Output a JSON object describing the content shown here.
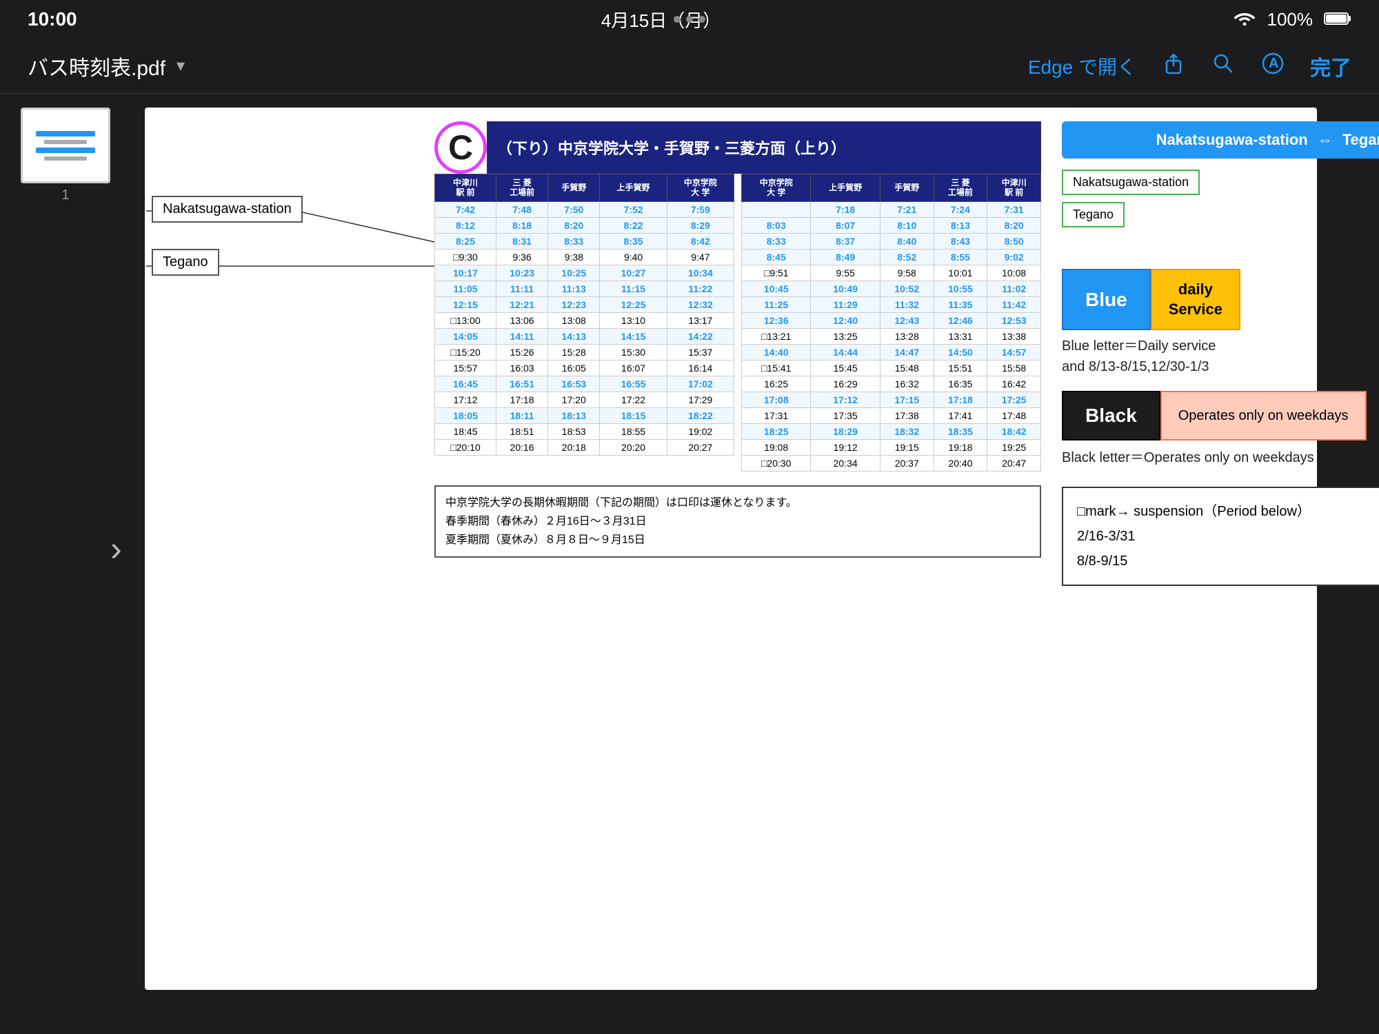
{
  "statusBar": {
    "time": "10:00",
    "date": "4月15日（月）",
    "wifi": "100%"
  },
  "toolbar": {
    "title": "バス時刻表.pdf",
    "openInEdge": "Edge で開く",
    "done": "完了"
  },
  "header": {
    "directionDown": "（下り）中京学院大学・手賀野・三菱方面（上り）",
    "routeLabel": "Nakatsugawa-station ⇔ Tegano"
  },
  "annotations": {
    "nakatsugawaStation": "Nakatsugawa-station",
    "tegano": "Tegano",
    "rightNakatsugawa": "Nakatsugawa-station",
    "rightTegano": "Tegano"
  },
  "legend": {
    "blueLabel": "Blue",
    "dailyServiceLabel": "daily\nService",
    "blueDescription": "Blue letter＝Daily service\nand 8/13-8/15,12/30-1/3",
    "blackLabel": "Black",
    "weekdaysLabel": "Operates only\non weekdays",
    "blackDescription": "Black letter＝Operates only on weekdays"
  },
  "squareMark": {
    "text": "□mark→  suspension（Period  below）\n2/16-3/31\n8/8-9/15"
  },
  "columnHeaders": {
    "left": [
      "中津川\n駅 前",
      "三 菱\n工場前",
      "手賀野",
      "上手賀野",
      "中京学院\n大 学"
    ],
    "right": [
      "中京学院\n大 学",
      "上手賀野",
      "手賀野",
      "三 菱\n工場前",
      "中津川\n駅 前"
    ]
  },
  "scheduleLeft": [
    [
      "7:42",
      "7:48",
      "7:50",
      "7:52",
      "7:59"
    ],
    [
      "8:12",
      "8:18",
      "8:20",
      "8:22",
      "8:29"
    ],
    [
      "8:25",
      "8:31",
      "8:33",
      "8:35",
      "8:42"
    ],
    [
      "□9:30",
      "9:36",
      "9:38",
      "9:40",
      "9:47"
    ],
    [
      "10:17",
      "10:23",
      "10:25",
      "10:27",
      "10:34"
    ],
    [
      "11:05",
      "11:11",
      "11:13",
      "11:15",
      "11:22"
    ],
    [
      "12:15",
      "12:21",
      "12:23",
      "12:25",
      "12:32"
    ],
    [
      "□13:00",
      "13:06",
      "13:08",
      "13:10",
      "13:17"
    ],
    [
      "14:05",
      "14:11",
      "14:13",
      "14:15",
      "14:22"
    ],
    [
      "□15:20",
      "15:26",
      "15:28",
      "15:30",
      "15:37"
    ],
    [
      "15:57",
      "16:03",
      "16:05",
      "16:07",
      "16:14"
    ],
    [
      "16:45",
      "16:51",
      "16:53",
      "16:55",
      "17:02"
    ],
    [
      "17:12",
      "17:18",
      "17:20",
      "17:22",
      "17:29"
    ],
    [
      "18:05",
      "18:11",
      "18:13",
      "18:15",
      "18:22"
    ],
    [
      "18:45",
      "18:51",
      "18:53",
      "18:55",
      "19:02"
    ],
    [
      "□20:10",
      "20:16",
      "20:18",
      "20:20",
      "20:27"
    ]
  ],
  "scheduleLeftColors": [
    "blue",
    "blue",
    "blue",
    "black",
    "blue",
    "blue",
    "blue",
    "black",
    "blue",
    "black",
    "black",
    "blue",
    "black",
    "blue",
    "black",
    "black"
  ],
  "scheduleRight": [
    [
      "",
      "",
      "7:18",
      "7:21",
      "7:24",
      "7:31"
    ],
    [
      "8:03",
      "8:07",
      "8:10",
      "8:13",
      "8:20"
    ],
    [
      "8:33",
      "8:37",
      "8:40",
      "8:43",
      "8:50"
    ],
    [
      "8:45",
      "8:49",
      "8:52",
      "8:55",
      "9:02"
    ],
    [
      "□9:51",
      "9:55",
      "9:58",
      "10:01",
      "10:08"
    ],
    [
      "10:45",
      "10:49",
      "10:52",
      "10:55",
      "11:02"
    ],
    [
      "11:25",
      "11:29",
      "11:32",
      "11:35",
      "11:42"
    ],
    [
      "12:36",
      "12:40",
      "12:43",
      "12:46",
      "12:53"
    ],
    [
      "□13:21",
      "13:25",
      "13:28",
      "13:31",
      "13:38"
    ],
    [
      "14:40",
      "14:44",
      "14:47",
      "14:50",
      "14:57"
    ],
    [
      "□15:41",
      "15:45",
      "15:48",
      "15:51",
      "15:58"
    ],
    [
      "16:25",
      "16:29",
      "16:32",
      "16:35",
      "16:42"
    ],
    [
      "17:08",
      "17:12",
      "17:15",
      "17:18",
      "17:25"
    ],
    [
      "17:31",
      "17:35",
      "17:38",
      "17:41",
      "17:48"
    ],
    [
      "18:25",
      "18:29",
      "18:32",
      "18:35",
      "18:42"
    ],
    [
      "19:08",
      "19:12",
      "19:15",
      "19:18",
      "19:25"
    ],
    [
      "□20:30",
      "20:34",
      "20:37",
      "20:40",
      "20:47"
    ]
  ],
  "scheduleRightColors": [
    "blue",
    "blue",
    "blue",
    "blue",
    "black",
    "blue",
    "blue",
    "blue",
    "black",
    "blue",
    "black",
    "black",
    "blue",
    "black",
    "blue",
    "black",
    "black"
  ],
  "bottomNote": {
    "line1": "中京学院大学の長期休暇期間（下記の期間）は口印は運休となります。",
    "line2": "春季期間（春休み）２月16日〜３月31日",
    "line3": "夏季期間（夏休み）８月８日〜９月15日"
  }
}
